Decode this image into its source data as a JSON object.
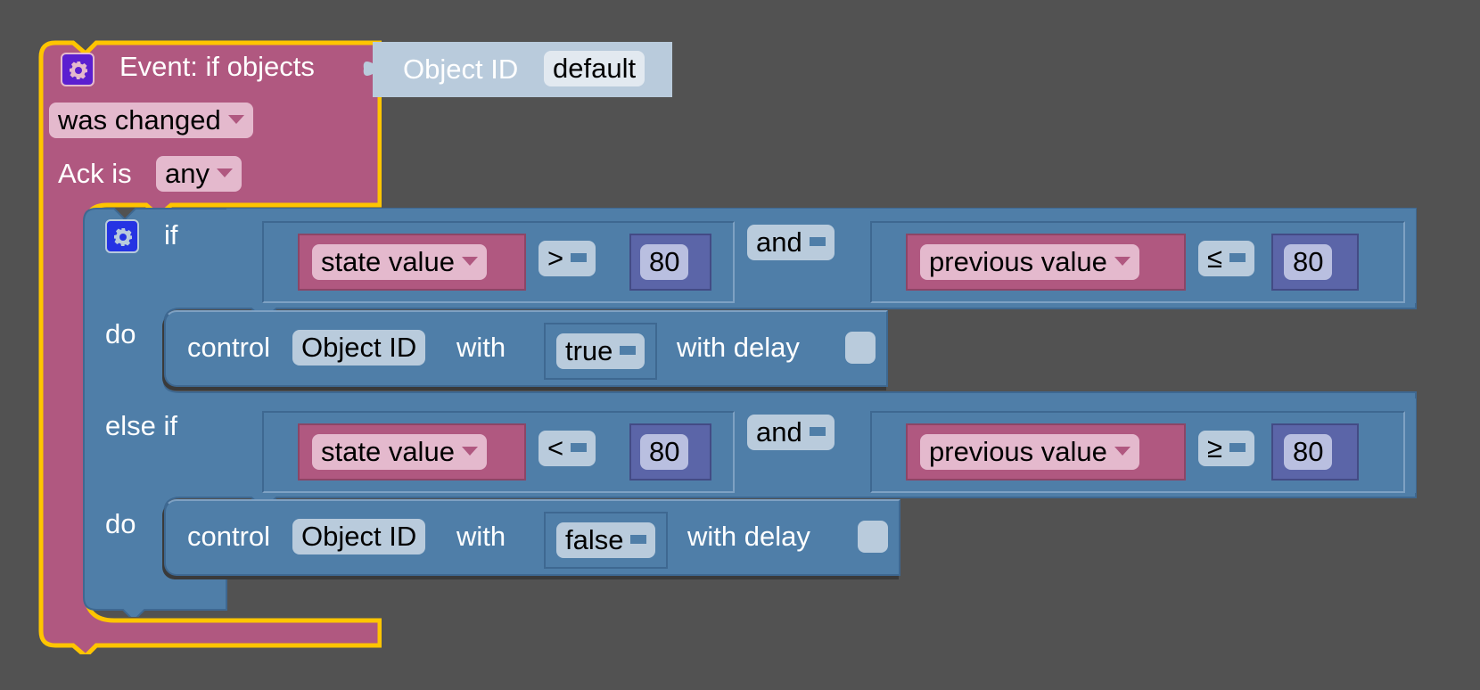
{
  "event_block": {
    "title": "Event: if objects",
    "trigger": "was changed",
    "ack_label": "Ack is",
    "ack_value": "any",
    "object_id_label": "Object ID",
    "object_id_value": "default"
  },
  "if_block": {
    "if_label": "if",
    "do_label": "do",
    "else_if_label": "else if",
    "branches": [
      {
        "left": {
          "field": "state value",
          "operator": ">",
          "value": "80"
        },
        "logic": "and",
        "right": {
          "field": "previous value",
          "operator": "≤",
          "value": "80"
        },
        "action": {
          "control_label": "control",
          "object": "Object ID",
          "with_label": "with",
          "value": "true",
          "delay_label": "with delay"
        }
      },
      {
        "left": {
          "field": "state value",
          "operator": "<",
          "value": "80"
        },
        "logic": "and",
        "right": {
          "field": "previous value",
          "operator": "≥",
          "value": "80"
        },
        "action": {
          "control_label": "control",
          "object": "Object ID",
          "with_label": "with",
          "value": "false",
          "delay_label": "with delay"
        }
      }
    ]
  },
  "colors": {
    "workspace": "#525252",
    "event_block": "#b05880",
    "selection_outline": "#ffc500",
    "logic_block": "#4f7ea8",
    "math_block": "#5b65a8",
    "object_id_block": "#b9cbdc"
  }
}
